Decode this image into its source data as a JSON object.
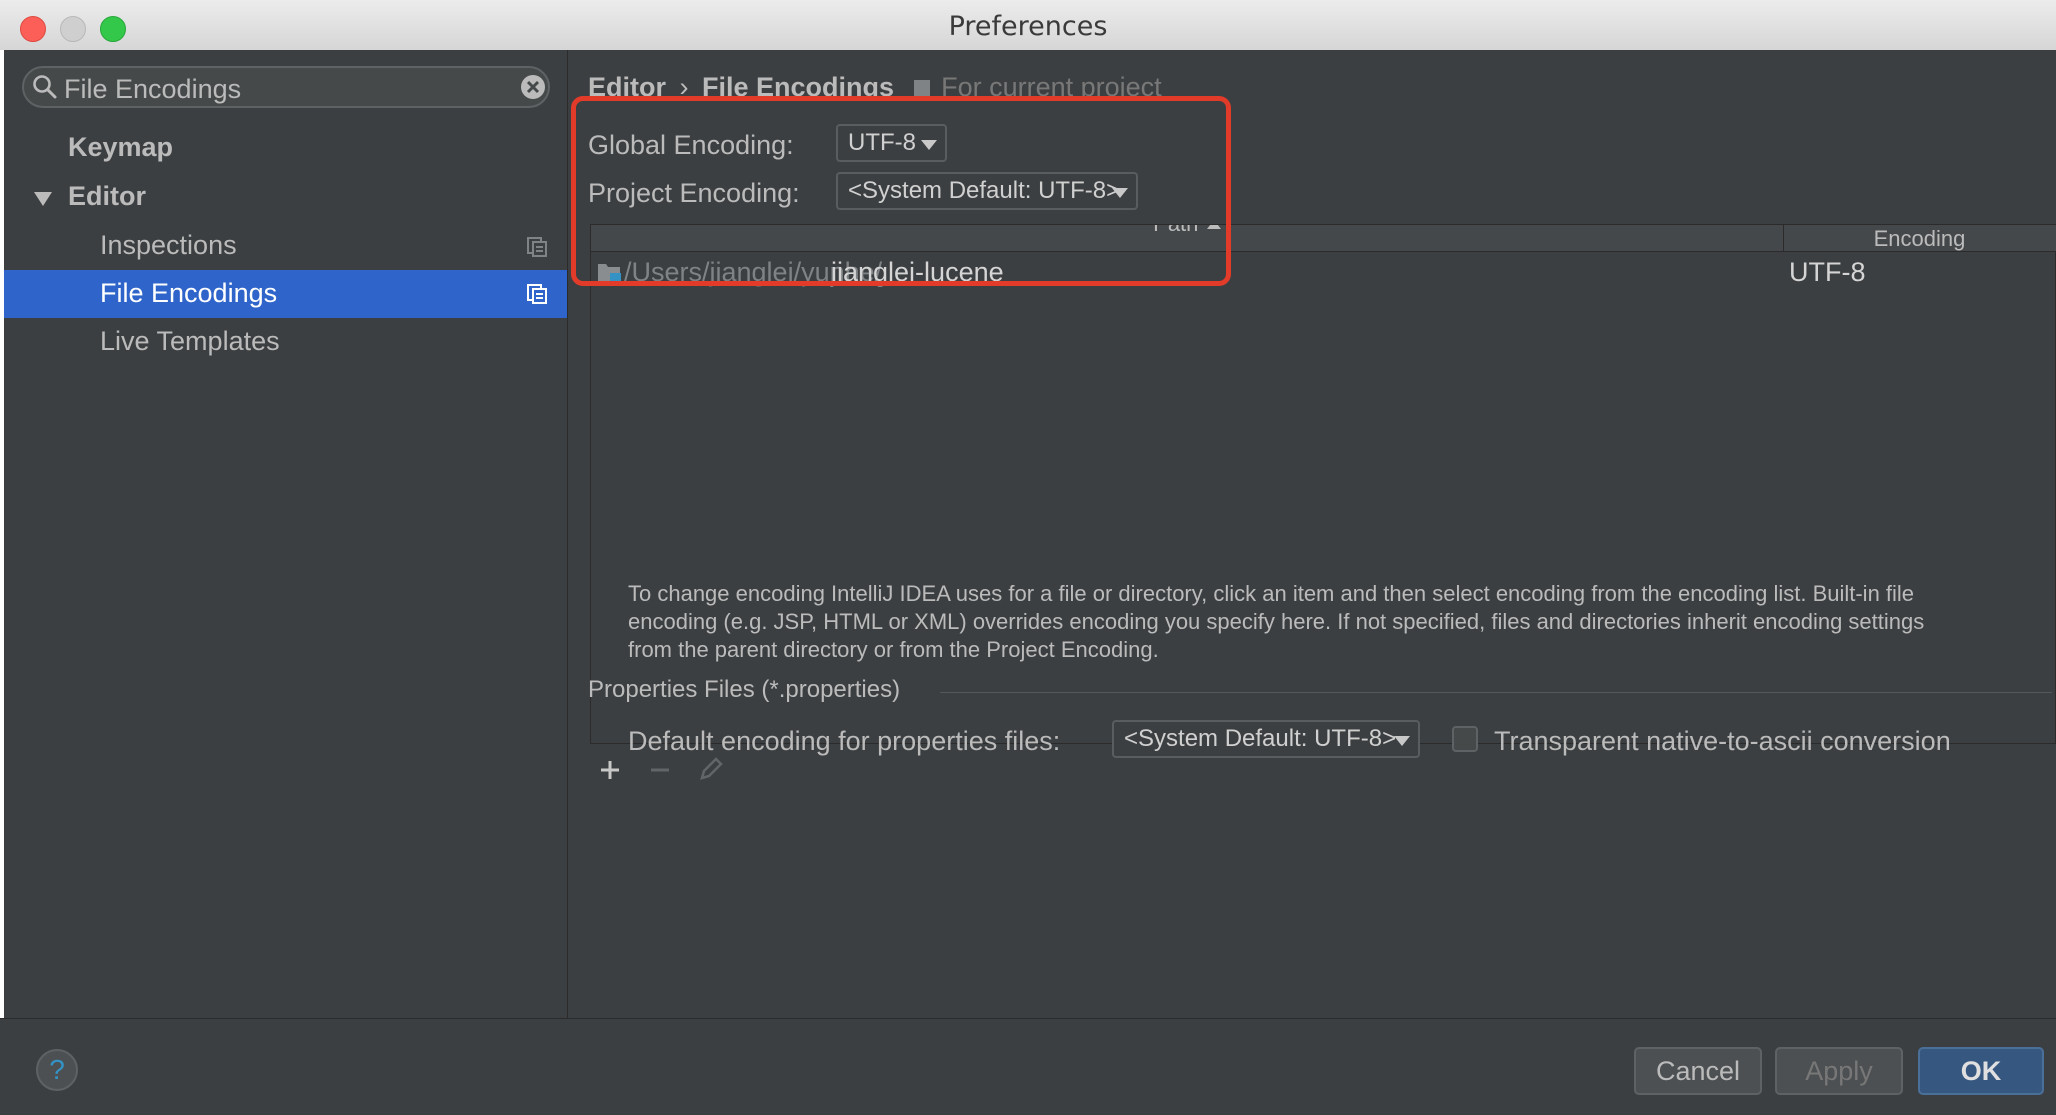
{
  "window": {
    "title": "Preferences"
  },
  "search": {
    "value": "File Encodings"
  },
  "sidebar": {
    "items": [
      {
        "label": "Keymap"
      },
      {
        "label": "Editor"
      },
      {
        "label": "Inspections"
      },
      {
        "label": "File Encodings"
      },
      {
        "label": "Live Templates"
      }
    ]
  },
  "breadcrumb": {
    "part1": "Editor",
    "separator": "›",
    "part2": "File Encodings",
    "scope": "For current project"
  },
  "encoding": {
    "global_label": "Global Encoding:",
    "global_value": "UTF-8",
    "project_label": "Project Encoding:",
    "project_value": "<System Default: UTF-8>"
  },
  "table": {
    "col_path": "Path",
    "col_encoding": "Encoding",
    "rows": [
      {
        "path_prefix": "/Users/jianglei/yunhe/",
        "path_name": "jianglei-lucene",
        "encoding": "UTF-8"
      }
    ]
  },
  "description": {
    "line1": "To change encoding IntelliJ IDEA uses for a file or directory, click an item and then select encoding from the encoding list. Built-in file",
    "line2": "encoding (e.g. JSP, HTML or XML) overrides encoding you specify here. If not specified, files and directories inherit encoding settings",
    "line3": "from the parent directory or from the Project Encoding."
  },
  "properties": {
    "section_title": "Properties Files (*.properties)",
    "default_label": "Default encoding for properties files:",
    "default_value": "<System Default: UTF-8>",
    "transparent_label": "Transparent native-to-ascii conversion",
    "transparent_checked": false
  },
  "footer": {
    "help": "?",
    "cancel": "Cancel",
    "apply": "Apply",
    "ok": "OK"
  },
  "colors": {
    "background": "#3c3f41",
    "selection": "#2f65ca",
    "highlight": "#e23b2a",
    "ok_button": "#365880"
  }
}
